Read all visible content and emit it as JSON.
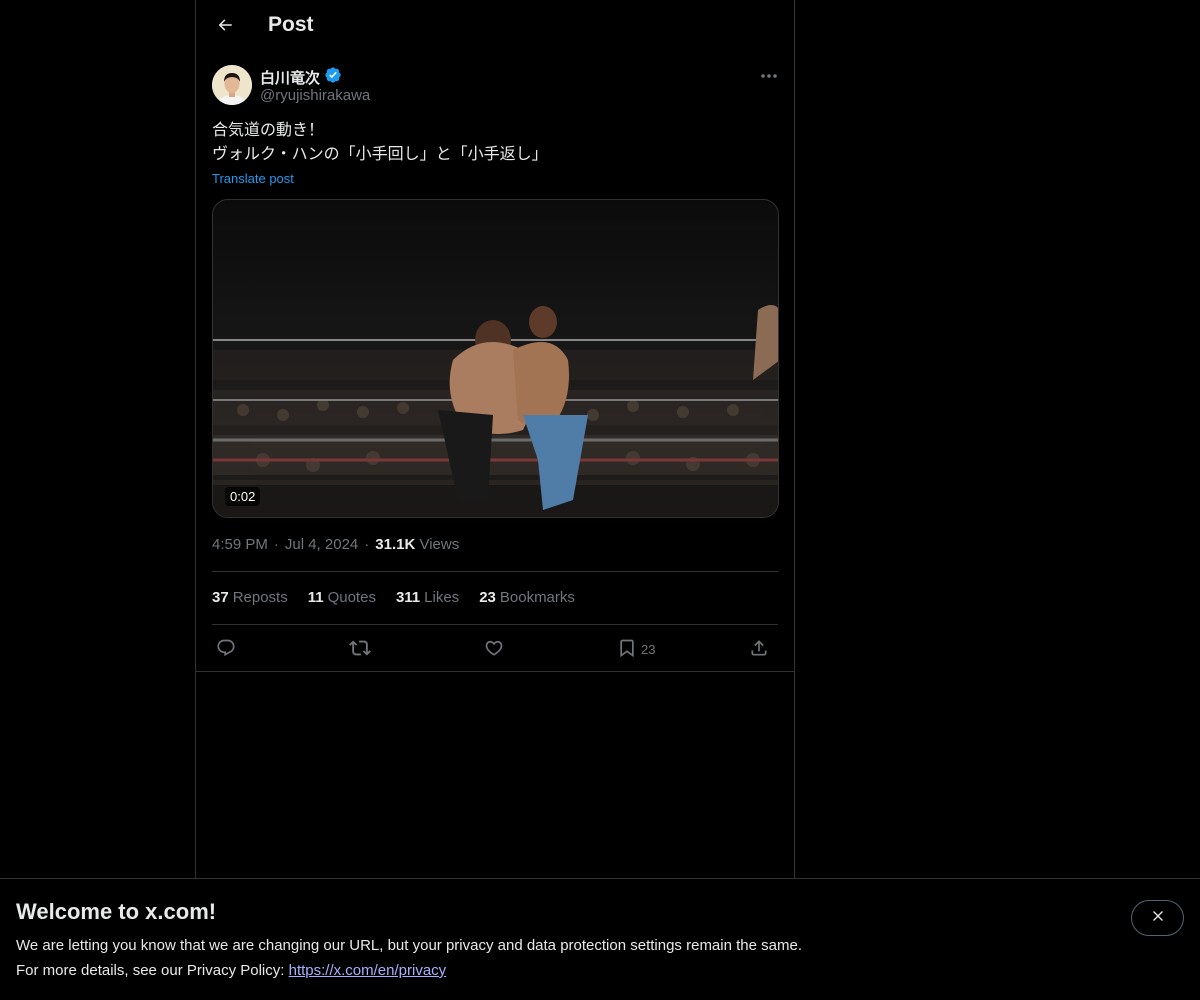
{
  "header": {
    "title": "Post",
    "back_icon": "arrow-left-icon"
  },
  "post": {
    "author": {
      "name": "白川竜次",
      "handle": "@ryujishirakawa",
      "verified": true,
      "verified_color": "#1d9bf0"
    },
    "text_line1": "合気道の動き！",
    "text_line2": "ヴォルク・ハンの「小手回し」と「小手返し」",
    "translate_label": "Translate post",
    "video_duration": "0:02",
    "time": "4:59 PM",
    "date": "Jul 4, 2024",
    "views_count": "31.1K",
    "views_label": "Views",
    "stats": {
      "reposts_count": "37",
      "reposts_label": "Reposts",
      "quotes_count": "11",
      "quotes_label": "Quotes",
      "likes_count": "311",
      "likes_label": "Likes",
      "bookmarks_count": "23",
      "bookmarks_label": "Bookmarks"
    },
    "actions": {
      "bookmark_count": "23"
    }
  },
  "banner": {
    "title": "Welcome to x.com!",
    "line1": "We are letting you know that we are changing our URL, but your privacy and data protection settings remain the same.",
    "line2_prefix": "For more details, see our Privacy Policy:",
    "link": "https://x.com/en/privacy"
  },
  "colors": {
    "accent": "#1d9bf0",
    "background": "#000000",
    "muted": "#71767b",
    "border": "#2f3336"
  }
}
